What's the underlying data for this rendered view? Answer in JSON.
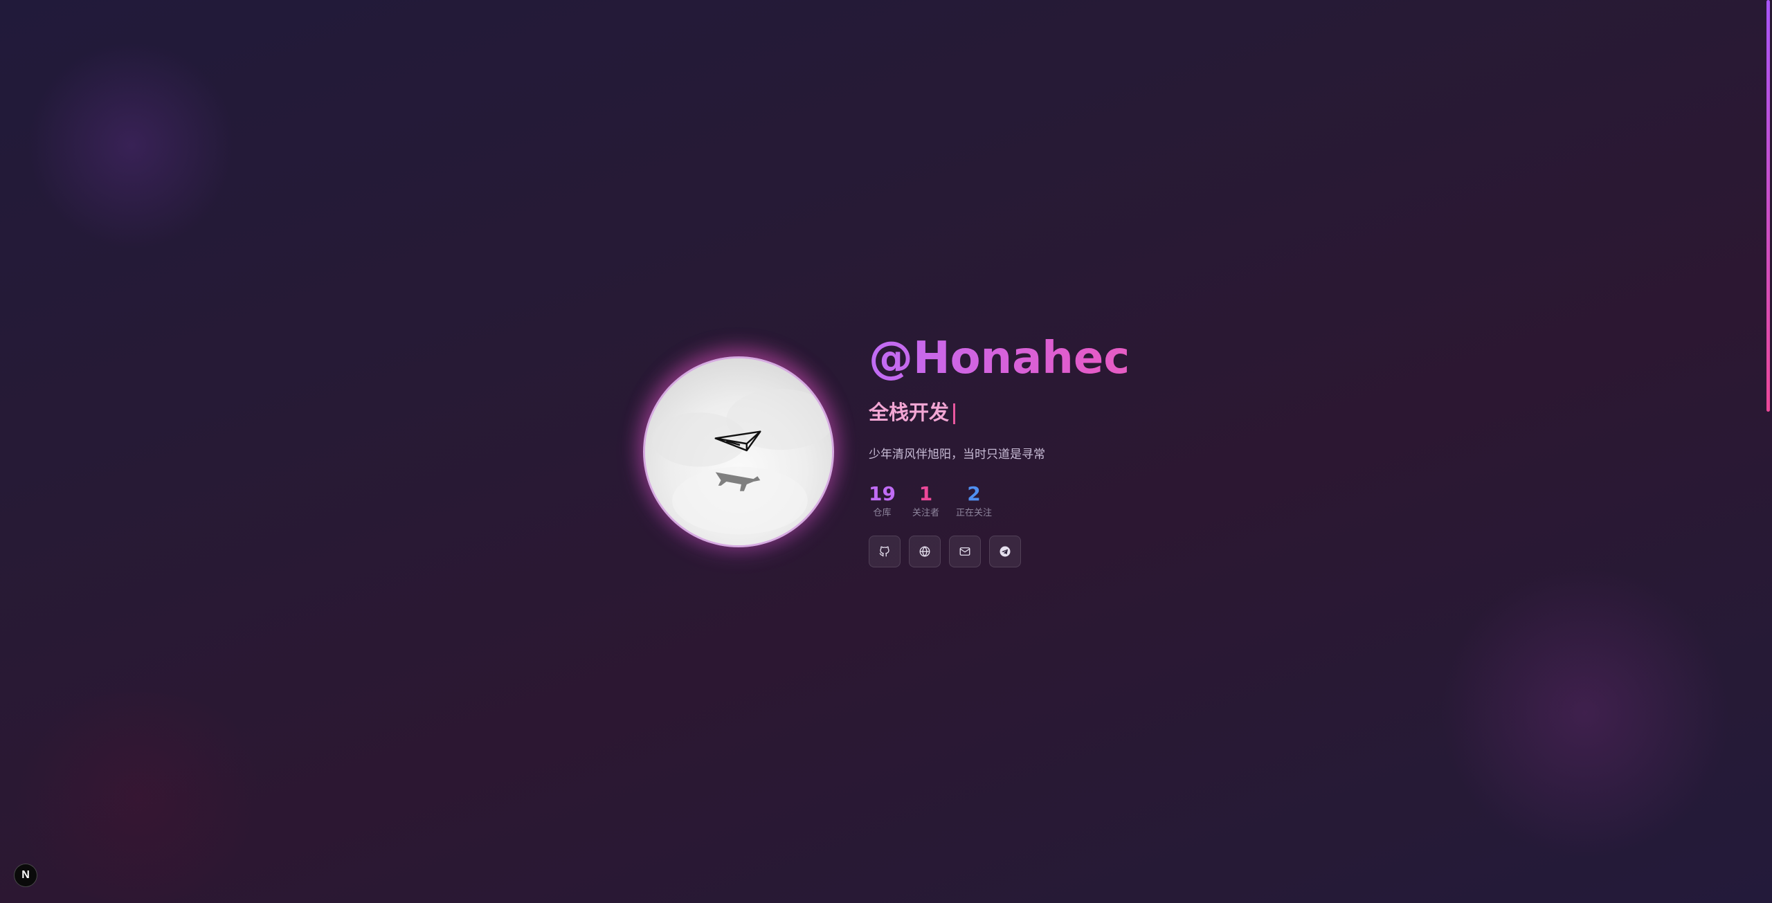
{
  "profile": {
    "username": "@Honahec",
    "role": "全栈开发",
    "bio": "少年清风伴旭阳，当时只道是寻常",
    "avatar_icon": "paper-plane-and-airplane-avatar"
  },
  "stats": [
    {
      "value": "19",
      "label": "仓库",
      "color": "#c06cf5"
    },
    {
      "value": "1",
      "label": "关注者",
      "color": "#ec4899"
    },
    {
      "value": "2",
      "label": "正在关注",
      "color": "#4f8ff0"
    }
  ],
  "socials": [
    {
      "icon": "github-icon"
    },
    {
      "icon": "globe-icon"
    },
    {
      "icon": "mail-icon"
    },
    {
      "icon": "telegram-icon"
    }
  ],
  "badge": {
    "label": "N"
  },
  "colors": {
    "accent_purple": "#c06cf5",
    "accent_pink": "#ec4899",
    "accent_blue": "#4f8ff0",
    "role_text": "#f3a6d4"
  }
}
